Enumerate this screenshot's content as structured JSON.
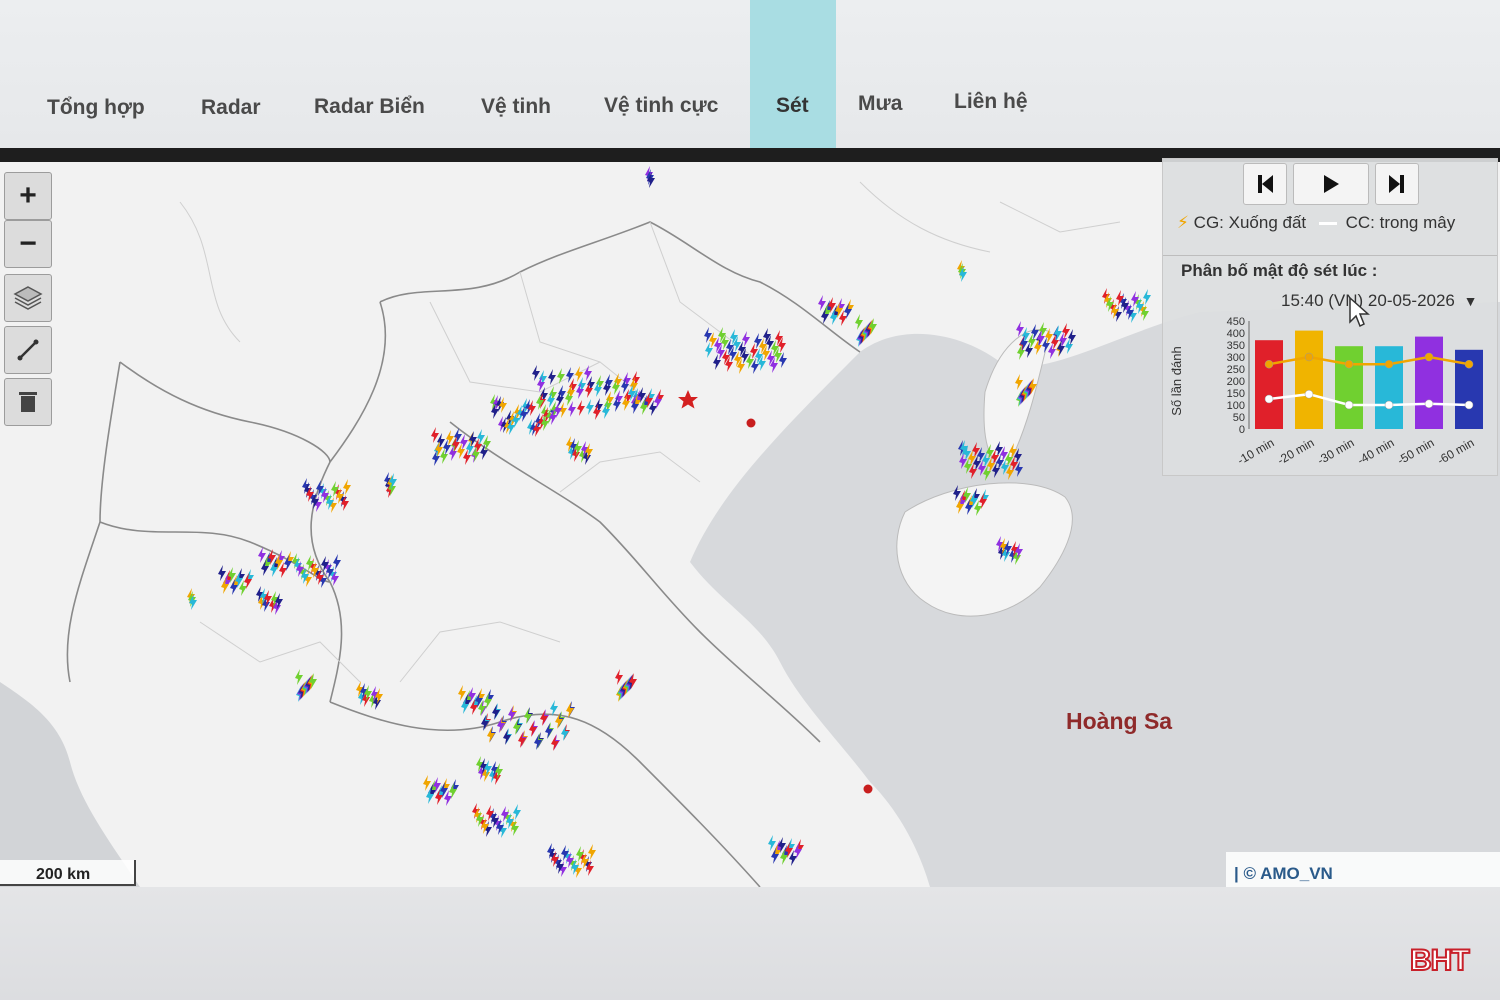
{
  "nav": {
    "items": [
      "Tổng hợp",
      "Radar",
      "Radar Biển",
      "Vệ tinh",
      "Vệ tinh cực",
      "Sét",
      "Mưa",
      "Liên hệ"
    ],
    "active": "Sét"
  },
  "map": {
    "zoom_in": "+",
    "zoom_out": "−",
    "scale_label": "200 km",
    "attribution": "| © AMO_VN",
    "place_label": "Hoàng Sa"
  },
  "panel": {
    "legend_cg": "CG: Xuống đất",
    "legend_cc": "CC: trong mây",
    "distribution_title": "Phân bố mật độ sét lúc :",
    "time_value": "15:40 (VN) 20-05-2026",
    "colors": {
      "cg": "#f0a500",
      "cc": "#ffffff"
    }
  },
  "chart_data": {
    "type": "bar",
    "ylabel": "Số lần đánh",
    "yticks": [
      0,
      50,
      100,
      150,
      200,
      250,
      300,
      350,
      400,
      450
    ],
    "ylim": [
      0,
      450
    ],
    "categories": [
      "-10 min",
      "-20 min",
      "-30 min",
      "-40 min",
      "-50 min",
      "-60 min"
    ],
    "bar_colors": [
      "#e0202a",
      "#f0b400",
      "#70d030",
      "#28b8d8",
      "#9030e0",
      "#2838b0"
    ],
    "values": [
      370,
      410,
      345,
      345,
      385,
      330
    ],
    "series": [
      {
        "values": [
          270,
          300,
          270,
          270,
          300,
          270
        ]
      },
      {
        "values": [
          125,
          145,
          100,
          100,
          105,
          100
        ]
      }
    ]
  },
  "brand": "BHT"
}
